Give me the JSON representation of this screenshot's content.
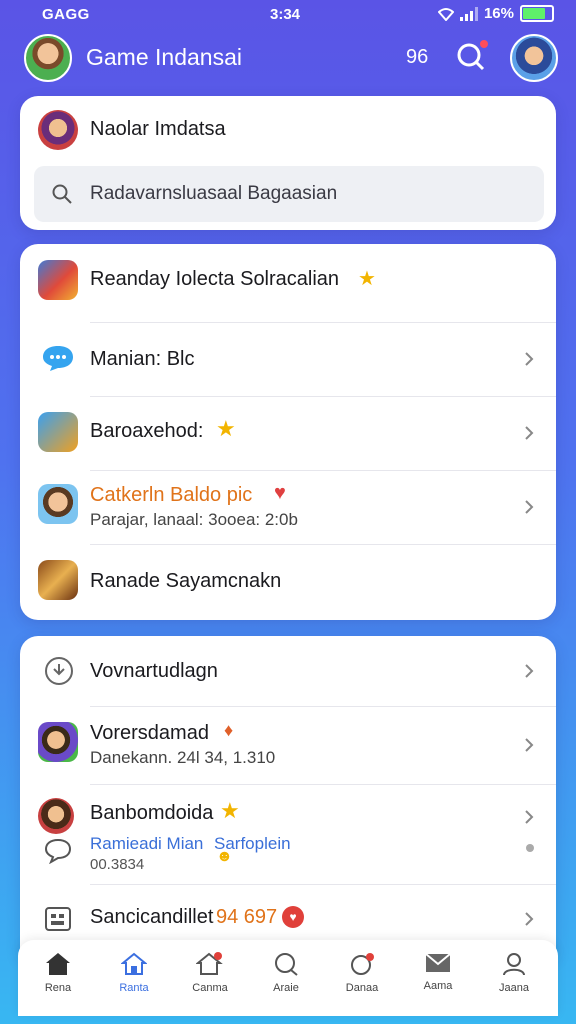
{
  "status_bar": {
    "carrier": "GAGG",
    "time": "3:34",
    "battery": "16%"
  },
  "header": {
    "title": "Game Indansai",
    "count": "96"
  },
  "profile": {
    "name": "Naolar Imdatsa"
  },
  "search": {
    "placeholder": "Radavarnsluasaal Bagaasian"
  },
  "list1": [
    {
      "title": "Reanday Iolecta Solracalian"
    },
    {
      "title": "Manian: Blc"
    },
    {
      "title": "Baroaxehod:"
    },
    {
      "title": "Catkerln Baldo pic",
      "subtitle": "Parajar, lanaal: 3ooea: 2:0b"
    },
    {
      "title": "Ranade Sayamcnakn"
    }
  ],
  "list2": [
    {
      "title": "Vovnartudlagn"
    },
    {
      "title": "Vorersdamad",
      "subtitle": "Danekann. 24l 34, 1.310"
    },
    {
      "title": "Banbomdoida",
      "subtitle": "Ramieadi Mian",
      "subtitle_link": "Sarfoplein",
      "extra": "00.3834"
    },
    {
      "title": "Sancicandillet",
      "badge": "94 697"
    }
  ],
  "tabs": [
    {
      "label": "Rena"
    },
    {
      "label": "Ranta"
    },
    {
      "label": "Canma"
    },
    {
      "label": "Araie"
    },
    {
      "label": "Danaa"
    },
    {
      "label": "Aama"
    },
    {
      "label": "Jaana"
    }
  ],
  "colors": {
    "accent": "#3b6fe0",
    "orange_text": "#e0731a",
    "link_blue": "#3a6fd8"
  },
  "icons": [
    "signal-icon",
    "battery-icon",
    "search-icon",
    "chevron-right-icon",
    "home-icon",
    "message-icon",
    "star-icon",
    "heart-icon"
  ]
}
